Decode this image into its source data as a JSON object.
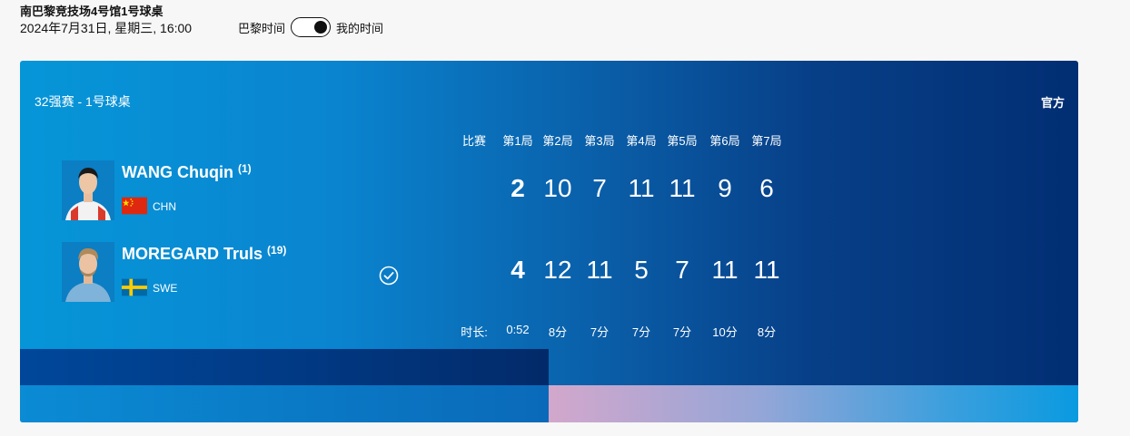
{
  "header": {
    "venue": "南巴黎竞技场4号馆1号球桌",
    "datetime": "2024年7月31日, 星期三, 16:00",
    "tz_left": "巴黎时间",
    "tz_right": "我的时间"
  },
  "match": {
    "round": "32强赛 - 1号球桌",
    "official": "官方",
    "columns": [
      "比赛",
      "第1局",
      "第2局",
      "第3局",
      "第4局",
      "第5局",
      "第6局",
      "第7局"
    ],
    "players": [
      {
        "name": "WANG Chuqin",
        "seed": "(1)",
        "country": "CHN",
        "match_score": "2",
        "games": [
          "10",
          "7",
          "11",
          "11",
          "9",
          "6"
        ]
      },
      {
        "name": "MOREGARD Truls",
        "seed": "(19)",
        "country": "SWE",
        "match_score": "4",
        "games": [
          "12",
          "11",
          "5",
          "7",
          "11",
          "11"
        ]
      }
    ],
    "duration_label": "时长:",
    "durations": [
      "0:52",
      "8分",
      "7分",
      "7分",
      "7分",
      "10分",
      "8分"
    ]
  },
  "colors": {
    "card_start": "#0696d8",
    "card_end": "#022e73",
    "china_red": "#de2910",
    "china_yellow": "#ffde00",
    "sweden_blue": "#006aa7",
    "sweden_yellow": "#fecc00"
  },
  "icons": {
    "winner": "check-circle-icon"
  }
}
